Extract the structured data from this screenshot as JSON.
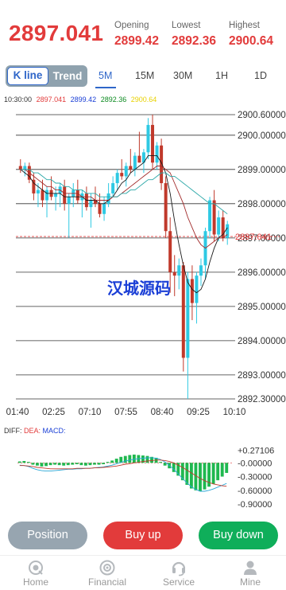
{
  "header": {
    "price": "2897.041",
    "stats": [
      {
        "label": "Opening",
        "value": "2899.42"
      },
      {
        "label": "Lowest",
        "value": "2892.36"
      },
      {
        "label": "Highest",
        "value": "2900.64"
      }
    ]
  },
  "tabs": {
    "mode": [
      "K line",
      "Trend"
    ],
    "active_mode": "K line",
    "timeframes": [
      "5M",
      "15M",
      "30M",
      "1H",
      "1D"
    ],
    "active_timeframe": "5M"
  },
  "legend": {
    "time": "10:30:00",
    "items": [
      {
        "value": "2897.041",
        "color": "#e23b3b"
      },
      {
        "value": "2899.42",
        "color": "#1a3fd6"
      },
      {
        "value": "2892.36",
        "color": "#0c8a20"
      },
      {
        "value": "2900.64",
        "color": "#e8d100"
      }
    ]
  },
  "chart_data": {
    "type": "candlestick",
    "ylim": [
      2892.3,
      2900.6
    ],
    "y_ticks": [
      "2900.60000",
      "2900.00000",
      "2899.00000",
      "2898.00000",
      "2897.00000",
      "2896.00000",
      "2895.00000",
      "2894.00000",
      "2893.00000",
      "2892.30000"
    ],
    "x_ticks": [
      "01:40",
      "02:25",
      "07:10",
      "07:55",
      "08:40",
      "09:25",
      "10:10"
    ],
    "current_price": "2897.041",
    "up_color": "#2ec9e3",
    "down_color": "#c0392b",
    "candles": [
      [
        2899.1,
        2899.3,
        2898.9,
        2899.0
      ],
      [
        2899.0,
        2899.2,
        2898.8,
        2899.1
      ],
      [
        2899.1,
        2899.2,
        2898.6,
        2898.7
      ],
      [
        2898.7,
        2898.9,
        2898.1,
        2898.3
      ],
      [
        2898.3,
        2898.6,
        2897.9,
        2898.4
      ],
      [
        2898.4,
        2898.7,
        2897.9,
        2898.1
      ],
      [
        2898.1,
        2898.5,
        2897.6,
        2898.4
      ],
      [
        2898.4,
        2898.8,
        2898.1,
        2898.2
      ],
      [
        2898.2,
        2898.5,
        2897.8,
        2898.3
      ],
      [
        2898.3,
        2898.6,
        2897.9,
        2898.5
      ],
      [
        2898.5,
        2898.7,
        2897.8,
        2898.0
      ],
      [
        2898.0,
        2898.3,
        2897.0,
        2898.2
      ],
      [
        2898.2,
        2898.6,
        2897.9,
        2898.4
      ],
      [
        2898.4,
        2898.7,
        2898.0,
        2898.1
      ],
      [
        2898.1,
        2898.4,
        2897.6,
        2898.3
      ],
      [
        2898.3,
        2898.5,
        2897.8,
        2897.9
      ],
      [
        2897.9,
        2898.3,
        2897.3,
        2898.1
      ],
      [
        2898.1,
        2898.5,
        2897.9,
        2898.0
      ],
      [
        2898.0,
        2898.3,
        2897.6,
        2897.7
      ],
      [
        2897.7,
        2898.2,
        2897.5,
        2898.0
      ],
      [
        2898.0,
        2898.6,
        2897.9,
        2898.3
      ],
      [
        2898.3,
        2898.8,
        2898.2,
        2898.6
      ],
      [
        2898.6,
        2899.0,
        2898.4,
        2898.9
      ],
      [
        2898.9,
        2899.3,
        2898.7,
        2898.8
      ],
      [
        2898.8,
        2899.2,
        2898.5,
        2899.1
      ],
      [
        2899.1,
        2899.6,
        2898.9,
        2899.0
      ],
      [
        2899.0,
        2899.5,
        2898.8,
        2899.4
      ],
      [
        2899.4,
        2900.1,
        2899.2,
        2899.2
      ],
      [
        2899.2,
        2899.6,
        2898.9,
        2899.5
      ],
      [
        2899.5,
        2900.5,
        2899.3,
        2900.3
      ],
      [
        2900.3,
        2900.6,
        2899.0,
        2899.2
      ],
      [
        2899.2,
        2899.8,
        2899.0,
        2899.7
      ],
      [
        2899.7,
        2899.9,
        2898.4,
        2898.6
      ],
      [
        2898.6,
        2898.8,
        2897.0,
        2897.2
      ],
      [
        2897.2,
        2897.6,
        2895.4,
        2896.0
      ],
      [
        2896.0,
        2896.5,
        2895.3,
        2895.9
      ],
      [
        2895.9,
        2896.4,
        2895.5,
        2896.2
      ],
      [
        2896.2,
        2896.3,
        2893.1,
        2893.5
      ],
      [
        2893.5,
        2896.0,
        2892.3,
        2895.8
      ],
      [
        2895.8,
        2896.2,
        2894.6,
        2895.1
      ],
      [
        2895.1,
        2896.0,
        2894.5,
        2895.9
      ],
      [
        2895.9,
        2896.4,
        2895.6,
        2896.2
      ],
      [
        2896.2,
        2897.3,
        2895.8,
        2897.2
      ],
      [
        2897.2,
        2898.2,
        2897.0,
        2898.1
      ],
      [
        2898.1,
        2898.4,
        2896.9,
        2897.1
      ],
      [
        2897.1,
        2897.8,
        2896.9,
        2897.6
      ],
      [
        2897.6,
        2897.8,
        2896.9,
        2897.0
      ],
      [
        2897.0,
        2897.5,
        2896.8,
        2897.4
      ]
    ],
    "ma_lines": [
      {
        "color": "#1a1a1a",
        "values": [
          2899.0,
          2898.9,
          2898.8,
          2898.6,
          2898.5,
          2898.4,
          2898.3,
          2898.3,
          2898.3,
          2898.3,
          2898.2,
          2898.2,
          2898.2,
          2898.2,
          2898.2,
          2898.1,
          2898.1,
          2898.1,
          2898.0,
          2898.0,
          2898.1,
          2898.2,
          2898.4,
          2898.6,
          2898.7,
          2898.9,
          2899.0,
          2899.1,
          2899.2,
          2899.4,
          2899.4,
          2899.4,
          2899.2,
          2898.9,
          2898.3,
          2897.5,
          2896.8,
          2896.2,
          2895.7,
          2895.5,
          2895.4,
          2895.5,
          2895.8,
          2896.3,
          2896.7,
          2897.0,
          2897.1,
          2897.3
        ]
      },
      {
        "color": "#a12a2a",
        "values": [
          2899.0,
          2899.0,
          2898.9,
          2898.8,
          2898.7,
          2898.6,
          2898.5,
          2898.5,
          2898.4,
          2898.4,
          2898.3,
          2898.3,
          2898.3,
          2898.3,
          2898.2,
          2898.2,
          2898.2,
          2898.1,
          2898.1,
          2898.1,
          2898.1,
          2898.2,
          2898.2,
          2898.3,
          2898.4,
          2898.5,
          2898.6,
          2898.7,
          2898.8,
          2898.9,
          2899.0,
          2899.1,
          2899.1,
          2899.0,
          2898.9,
          2898.6,
          2898.3,
          2898.0,
          2897.6,
          2897.3,
          2897.0,
          2896.8,
          2896.7,
          2896.8,
          2896.9,
          2897.0,
          2897.0,
          2897.1
        ]
      },
      {
        "color": "#2aa7a7",
        "values": [
          2899.0,
          2899.0,
          2899.0,
          2898.9,
          2898.9,
          2898.8,
          2898.7,
          2898.7,
          2898.6,
          2898.6,
          2898.5,
          2898.5,
          2898.4,
          2898.4,
          2898.4,
          2898.3,
          2898.3,
          2898.3,
          2898.2,
          2898.2,
          2898.2,
          2898.2,
          2898.2,
          2898.3,
          2898.3,
          2898.4,
          2898.4,
          2898.5,
          2898.6,
          2898.7,
          2898.7,
          2898.8,
          2898.9,
          2898.9,
          2898.8,
          2898.8,
          2898.7,
          2898.6,
          2898.5,
          2898.4,
          2898.3,
          2898.2,
          2898.1,
          2898.0,
          2898.0,
          2897.9,
          2897.8,
          2897.7
        ]
      }
    ]
  },
  "macd": {
    "legend": [
      {
        "text": "DIFF:",
        "color": "#333"
      },
      {
        "text": "DEA:",
        "color": "#e23b3b"
      },
      {
        "text": "MACD:",
        "color": "#1a3fd6"
      }
    ],
    "ylim": [
      -0.95,
      0.3
    ],
    "y_ticks": [
      "+0.27106",
      "-0.00000",
      "-0.30000",
      "-0.60000",
      "-0.90000"
    ],
    "hist": [
      0.03,
      0.04,
      0.02,
      -0.04,
      -0.06,
      -0.08,
      -0.07,
      -0.05,
      -0.04,
      -0.05,
      -0.06,
      -0.05,
      -0.04,
      -0.03,
      -0.05,
      -0.06,
      -0.05,
      -0.04,
      -0.04,
      -0.03,
      0.02,
      0.05,
      0.09,
      0.13,
      0.15,
      0.17,
      0.18,
      0.17,
      0.16,
      0.15,
      0.13,
      0.11,
      0.02,
      -0.06,
      -0.12,
      -0.2,
      -0.28,
      -0.38,
      -0.48,
      -0.56,
      -0.6,
      -0.62,
      -0.58,
      -0.52,
      -0.46,
      -0.38,
      -0.3,
      -0.22
    ],
    "diff": [
      -0.05,
      -0.06,
      -0.08,
      -0.12,
      -0.15,
      -0.17,
      -0.18,
      -0.18,
      -0.17,
      -0.16,
      -0.15,
      -0.14,
      -0.14,
      -0.13,
      -0.13,
      -0.12,
      -0.12,
      -0.11,
      -0.1,
      -0.09,
      -0.07,
      -0.05,
      -0.02,
      0.01,
      0.04,
      0.06,
      0.08,
      0.09,
      0.1,
      0.11,
      0.11,
      0.1,
      0.07,
      0.02,
      -0.06,
      -0.14,
      -0.24,
      -0.34,
      -0.44,
      -0.52,
      -0.58,
      -0.62,
      -0.62,
      -0.6,
      -0.57,
      -0.53,
      -0.49,
      -0.45
    ],
    "dea": [
      -0.06,
      -0.06,
      -0.07,
      -0.08,
      -0.1,
      -0.11,
      -0.12,
      -0.13,
      -0.13,
      -0.13,
      -0.13,
      -0.13,
      -0.13,
      -0.12,
      -0.12,
      -0.12,
      -0.12,
      -0.11,
      -0.11,
      -0.1,
      -0.09,
      -0.08,
      -0.07,
      -0.05,
      -0.03,
      -0.02,
      0.0,
      0.01,
      0.03,
      0.04,
      0.05,
      0.06,
      0.06,
      0.05,
      0.03,
      0.0,
      -0.05,
      -0.1,
      -0.16,
      -0.22,
      -0.28,
      -0.34,
      -0.39,
      -0.43,
      -0.46,
      -0.48,
      -0.5,
      -0.51
    ]
  },
  "buttons": {
    "position": "Position",
    "buy_up": "Buy up",
    "buy_down": "Buy down"
  },
  "watermark": "汉城源码",
  "nav": [
    {
      "label": "Home",
      "icon": "home-icon"
    },
    {
      "label": "Financial",
      "icon": "financial-icon"
    },
    {
      "label": "Service",
      "icon": "service-icon"
    },
    {
      "label": "Mine",
      "icon": "user-icon"
    }
  ]
}
